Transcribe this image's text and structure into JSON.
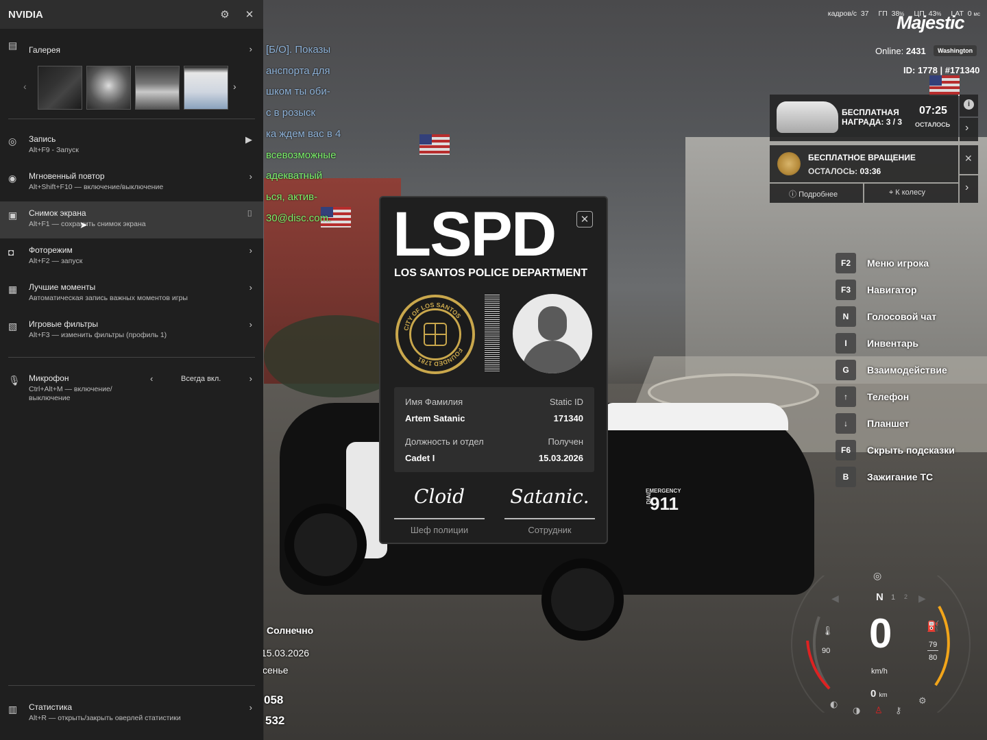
{
  "nvidia": {
    "title": "NVIDIA",
    "gallery": {
      "label": "Галерея"
    },
    "items": [
      {
        "label": "Запись",
        "sub": "Alt+F9 - Запуск"
      },
      {
        "label": "Мгновенный повтор",
        "sub": "Alt+Shift+F10 — включение/выключение"
      },
      {
        "label": "Снимок экрана",
        "sub": "Alt+F1 — сохранить снимок экрана"
      },
      {
        "label": "Фоторежим",
        "sub": "Alt+F2 — запуск"
      },
      {
        "label": "Лучшие моменты",
        "sub": "Автоматическая запись важных моментов игры"
      },
      {
        "label": "Игровые фильтры",
        "sub": "Alt+F3 — изменить фильтры (профиль 1)"
      }
    ],
    "mic": {
      "label": "Микрофон",
      "sub": "Ctrl+Alt+M — включение/ выключение",
      "value": "Всегда вкл."
    },
    "stats": {
      "label": "Статистика",
      "sub": "Alt+R — открыть/закрыть оверлей статистики"
    }
  },
  "chat": [
    {
      "text": "[Б/О]. Показы",
      "color": "#8fb3d9"
    },
    {
      "text": "анспорта для",
      "color": "#8fb3d9"
    },
    {
      "text": "шком ты оби-",
      "color": "#8fb3d9"
    },
    {
      "text": "с в розыск",
      "color": "#8fb3d9"
    },
    {
      "text": "ка ждем вас в 4",
      "color": "#8fb3d9"
    },
    {
      "text": "всевозможные",
      "color": "#7cf26a"
    },
    {
      "text": "адекватный",
      "color": "#7cf26a"
    },
    {
      "text": "ься, актив-",
      "color": "#7cf26a"
    },
    {
      "text": "30@disc.com.",
      "color": "#7cf26a"
    }
  ],
  "world": {
    "weather": "Солнечно",
    "date": "15.03.2026",
    "season": "сенье",
    "num1": "058",
    "num2": "532"
  },
  "hud": {
    "fps_label": "кадров/с",
    "fps": "37",
    "gpu_label": "ГП",
    "gpu": "38",
    "cpu_label": "ЦП",
    "cpu": "43",
    "lat_label": "LAT",
    "lat": "0",
    "pct": "%",
    "ms": "мс",
    "logo": "Majestic",
    "online_label": "Online:",
    "online": "2431",
    "server": "Washington",
    "id_line": "ID: 1778 | #171340"
  },
  "reward": {
    "title": "БЕСПЛАТНАЯ",
    "title2": "НАГРАДА: 3 / 3",
    "time": "07:25",
    "time_label": "ОСТАЛОСЬ"
  },
  "spin": {
    "title": "БЕСПЛАТНОЕ ВРАЩЕНИЕ",
    "left_label": "ОСТАЛОСЬ:",
    "left": "03:36",
    "more": "Подробнее",
    "wheel": "К колесу"
  },
  "hints": [
    {
      "key": "F2",
      "label": "Меню игрока"
    },
    {
      "key": "F3",
      "label": "Навигатор"
    },
    {
      "key": "N",
      "label": "Голосовой чат"
    },
    {
      "key": "I",
      "label": "Инвентарь"
    },
    {
      "key": "G",
      "label": "Взаимодействие"
    },
    {
      "key": "↑",
      "label": "Телефон"
    },
    {
      "key": "↓",
      "label": "Планшет"
    },
    {
      "key": "F6",
      "label": "Скрыть подсказки"
    },
    {
      "key": "B",
      "label": "Зажигание ТС"
    }
  ],
  "lspd": {
    "big": "LSPD",
    "dept": "LOS SANTOS POLICE DEPARTMENT",
    "seal_top": "CITY OF LOS SANTOS",
    "seal_bottom": "FOUNDED 1781",
    "name_label": "Имя Фамилия",
    "name": "Artem Satanic",
    "static_label": "Static ID",
    "static": "171340",
    "post_label": "Должность и отдел",
    "post": "Cadet I",
    "recv_label": "Получен",
    "recv": "15.03.2026",
    "sig1": "Cloid",
    "sig1_cap": "Шеф полиции",
    "sig2": "Satanic.",
    "sig2_cap": "Сотрудник"
  },
  "car": {
    "emergency": "EMERGENCY",
    "dial": "DIAL",
    "number": "911"
  },
  "speedo": {
    "gear": "N",
    "g1": "1",
    "g2": "2",
    "speed": "0",
    "unit": "km/h",
    "temp": "90",
    "fuel": "79",
    "fuel_max": "80",
    "odo": "0",
    "odo_unit": "km"
  }
}
